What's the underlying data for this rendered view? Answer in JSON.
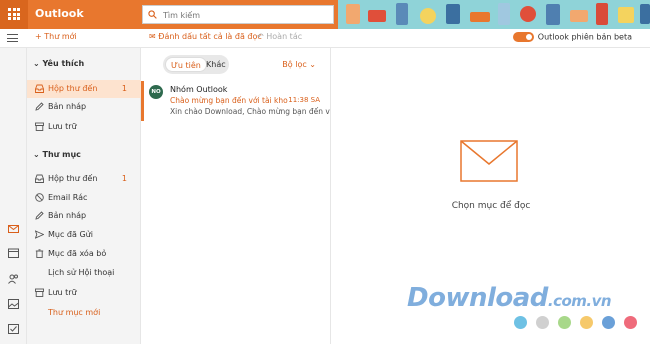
{
  "app": {
    "brand": "Outlook"
  },
  "search": {
    "placeholder": "Tìm kiếm"
  },
  "commands": {
    "new_mail": "+ Thư mới",
    "mark_all_read": "Đánh dấu tất cả là đã đọc",
    "undo": "Hoàn tác",
    "beta_toggle_label": "Outlook phiên bản beta",
    "beta_enabled": true
  },
  "folders": {
    "favorites_header": "Yêu thích",
    "favorites": [
      {
        "label": "Hộp thư đến",
        "count": "1",
        "selected": true,
        "icon": "inbox-icon"
      },
      {
        "label": "Bản nháp",
        "count": "",
        "icon": "pencil-icon"
      },
      {
        "label": "Lưu trữ",
        "count": "",
        "icon": "archive-icon"
      }
    ],
    "folders_header": "Thư mục",
    "all": [
      {
        "label": "Hộp thư đến",
        "count": "1",
        "icon": "inbox-icon"
      },
      {
        "label": "Email Rác",
        "count": "",
        "icon": "junk-icon"
      },
      {
        "label": "Bản nháp",
        "count": "",
        "icon": "pencil-icon"
      },
      {
        "label": "Mục đã Gửi",
        "count": "",
        "icon": "send-icon"
      },
      {
        "label": "Mục đã xóa bỏ",
        "count": "",
        "icon": "trash-icon"
      },
      {
        "label": "Lịch sử Hội thoại",
        "count": "",
        "icon": ""
      },
      {
        "label": "Lưu trữ",
        "count": "",
        "icon": "archive-icon"
      }
    ],
    "new_folder": "Thư mục mới"
  },
  "message_list": {
    "tabs": [
      "Ưu tiên",
      "Khác"
    ],
    "active_tab": "Ưu tiên",
    "filter": "Bộ lọc",
    "messages": [
      {
        "initials": "NO",
        "sender": "Nhóm Outlook",
        "subject": "Chào mừng bạn đến với tài kho...",
        "time": "11:38 SA",
        "preview": "Xin chào Download, Chào mừng bạn đến với..."
      }
    ]
  },
  "reading_pane": {
    "empty_text": "Chọn mục để đọc"
  },
  "watermark": {
    "text": "Download",
    "domain": ".com.vn"
  },
  "colors": {
    "accent": "#e8772e",
    "accent_text": "#d95f1a",
    "selected_bg": "#fde3cf",
    "avatar": "#2e6a4e"
  },
  "decor_dots": [
    "#6ec1e4",
    "#d0d0d0",
    "#a8d88a",
    "#f6c96b",
    "#6aa0d8",
    "#ef6b7b"
  ]
}
